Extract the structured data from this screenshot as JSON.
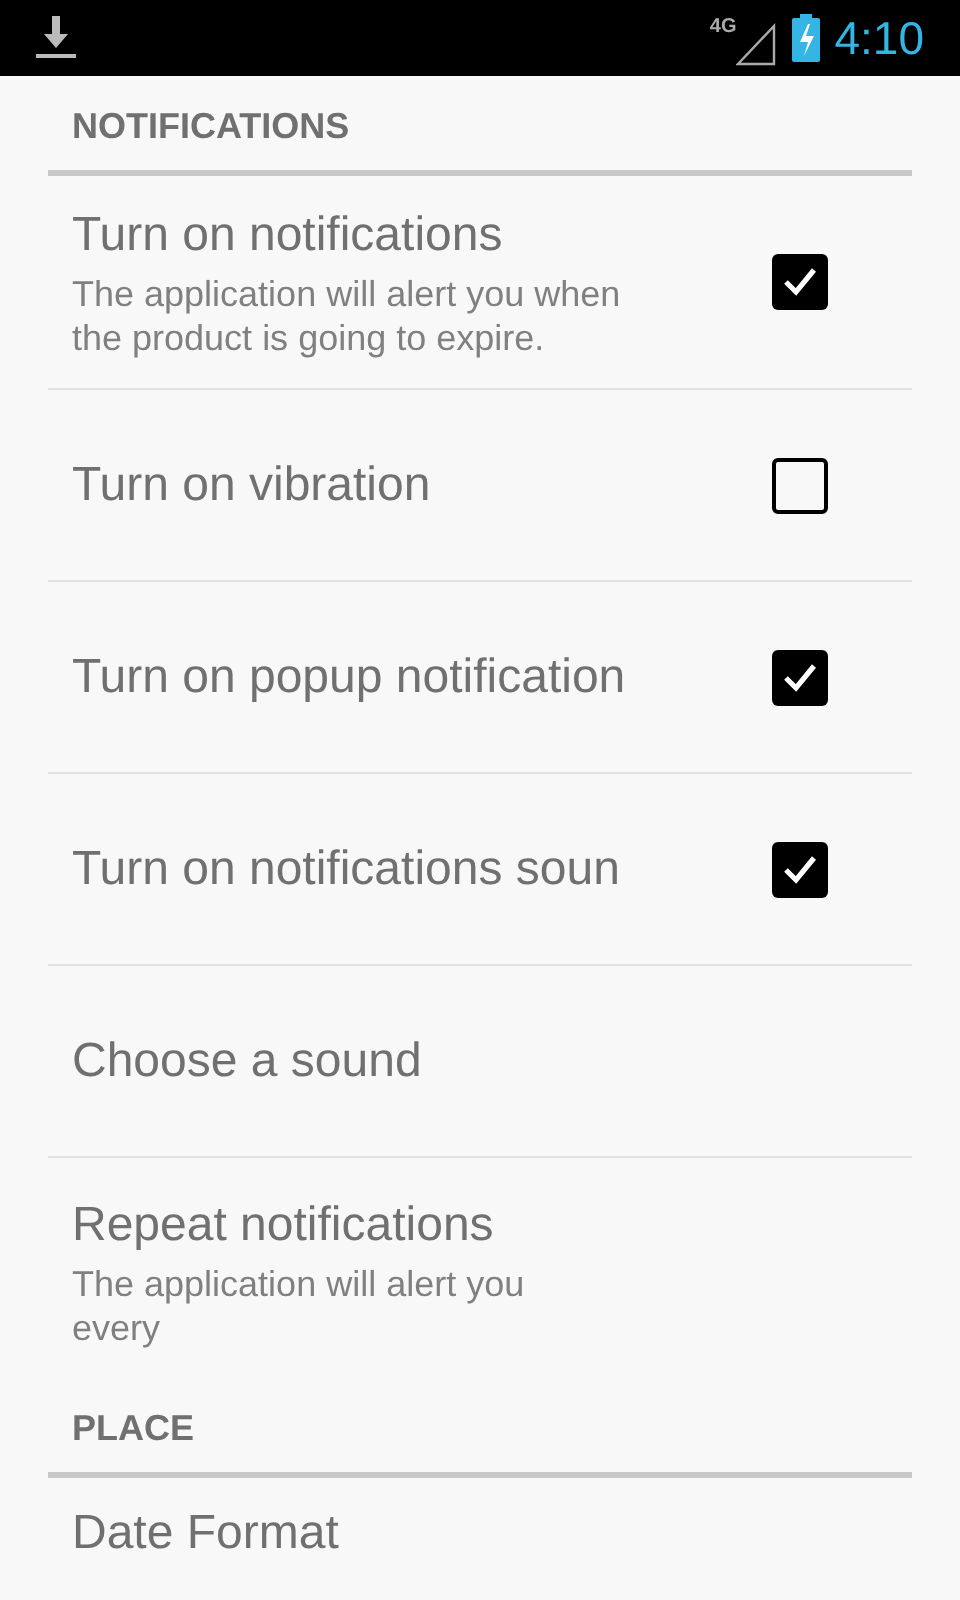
{
  "status_bar": {
    "time": "4:10",
    "network": "4G"
  },
  "sections": [
    {
      "header": "NOTIFICATIONS",
      "items": [
        {
          "kind": "checkbox",
          "title": "Turn on notifications",
          "summary": "The application will alert you when the product is going to expire.",
          "checked": true
        },
        {
          "kind": "checkbox",
          "title": "Turn on vibration",
          "checked": false
        },
        {
          "kind": "checkbox",
          "title": "Turn on popup notification",
          "checked": true
        },
        {
          "kind": "checkbox",
          "title": "Turn on notifications soun",
          "checked": true
        },
        {
          "kind": "plain",
          "title": "Choose a sound"
        },
        {
          "kind": "plain",
          "title": "Repeat notifications",
          "summary": "The application will alert you every"
        }
      ]
    },
    {
      "header": "PLACE",
      "items": [
        {
          "kind": "plain",
          "title": "Date Format"
        }
      ]
    }
  ]
}
